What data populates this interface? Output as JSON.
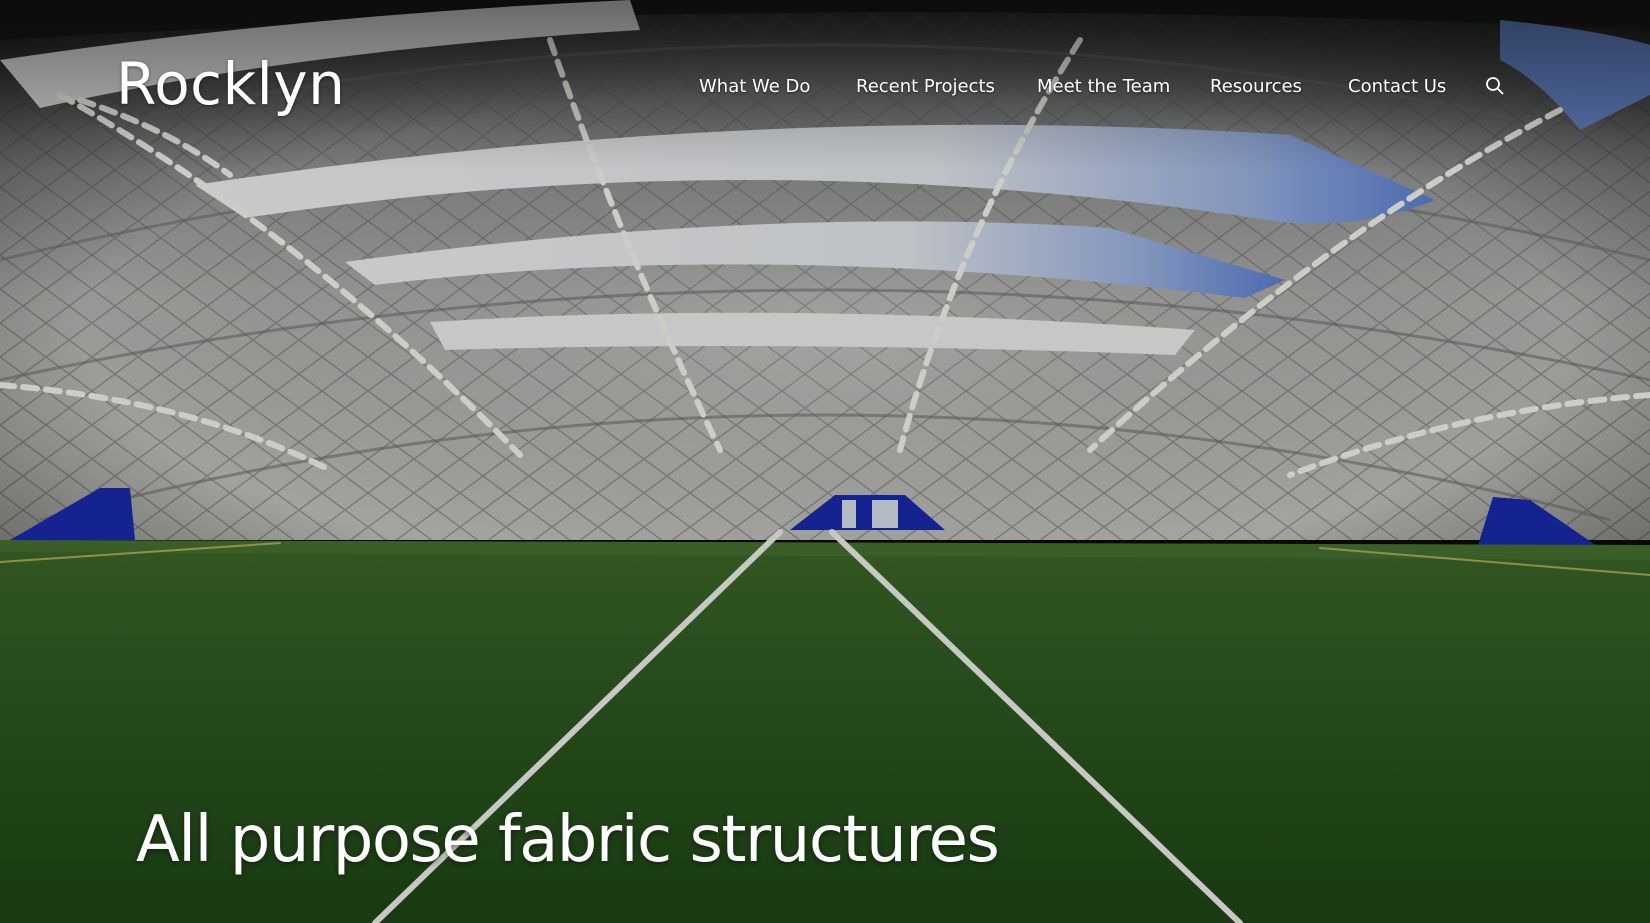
{
  "brand": {
    "logo_text": "Rocklyn"
  },
  "nav": {
    "items": [
      {
        "label": "What We Do"
      },
      {
        "label": "Recent Projects"
      },
      {
        "label": "Meet the Team"
      },
      {
        "label": "Resources"
      },
      {
        "label": "Contact Us"
      }
    ],
    "search_icon": "search-icon"
  },
  "hero": {
    "title": "All purpose fabric structures",
    "background": "indoor air-dome sports field with artificial turf"
  },
  "colors": {
    "text": "#ffffff",
    "turf": "#2f5a22",
    "dome": "#b8b9b5",
    "light_panel": "#f4f5f5",
    "accent_blue": "#1f2fa8"
  }
}
